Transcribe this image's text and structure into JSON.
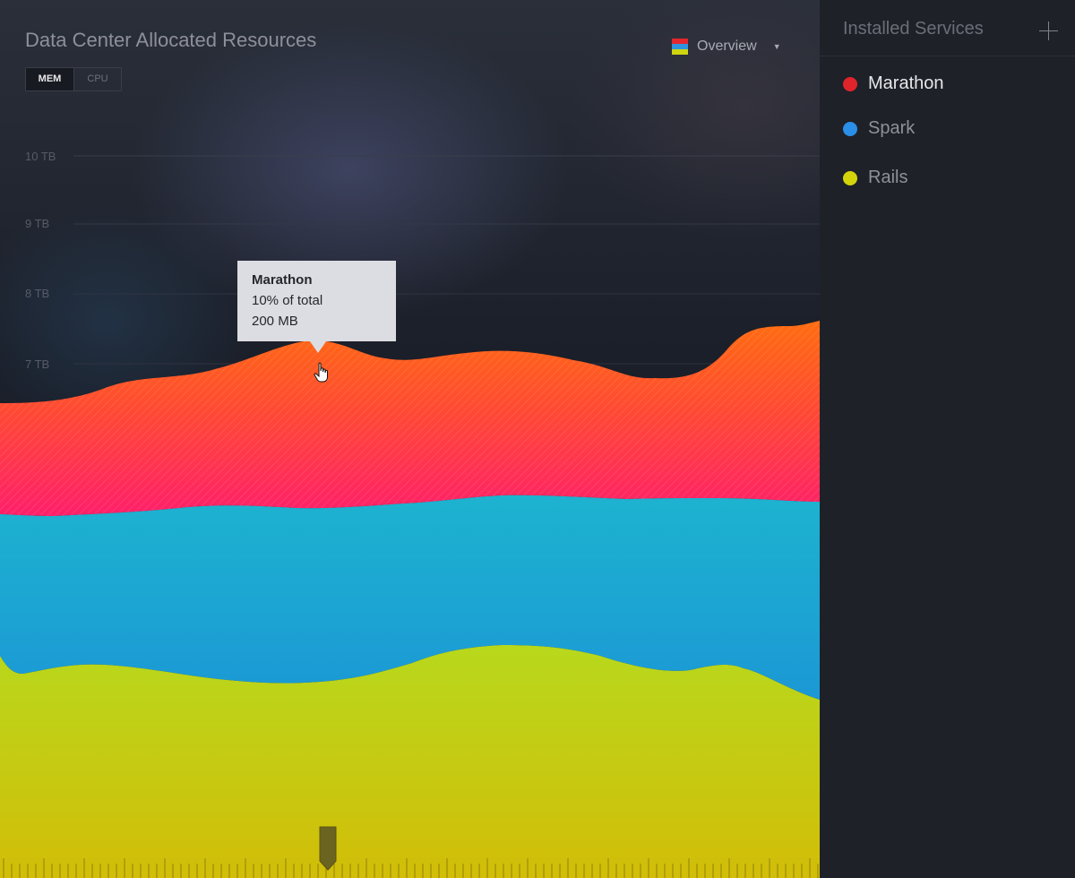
{
  "header": {
    "title": "Data Center Allocated Resources",
    "toggle": [
      {
        "label": "MEM",
        "active": true
      },
      {
        "label": "CPU",
        "active": false
      }
    ],
    "dropdown": {
      "label": "Overview",
      "icon": "overview-color-stack-icon"
    }
  },
  "chart_data": {
    "type": "area",
    "stacked": true,
    "y_ticks": [
      "10 TB",
      "9 TB",
      "8 TB",
      "7 TB"
    ],
    "series": [
      {
        "name": "Marathon",
        "color": "#ff3d5f"
      },
      {
        "name": "Spark",
        "color": "#1fb1d3"
      },
      {
        "name": "Rails",
        "color": "#c6cc10"
      }
    ],
    "tooltip": {
      "series": "Marathon",
      "share": "10% of total",
      "value": "200 MB"
    },
    "grid": true
  },
  "sidebar": {
    "title": "Installed Services",
    "add_icon": "plus-icon",
    "services": [
      {
        "name": "Marathon",
        "color": "#e0242c",
        "active": true
      },
      {
        "name": "Spark",
        "color": "#2a8fe8",
        "active": false
      },
      {
        "name": "Rails",
        "color": "#d5d40b",
        "active": false
      }
    ]
  }
}
